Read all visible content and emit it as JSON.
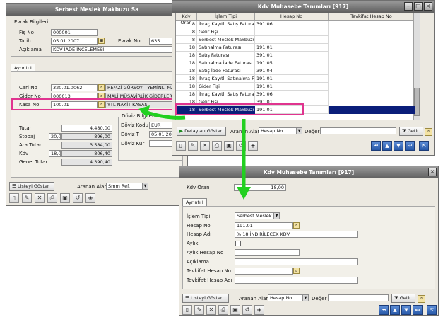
{
  "win1": {
    "title": "Serbest Meslek Makbuzu Sa",
    "evrak_group": "Evrak Bilgileri",
    "fis_no_label": "Fiş No",
    "fis_no": "000001",
    "tarih_label": "Tarih",
    "tarih": "05.01.2007",
    "evrak_no_label": "Evrak No",
    "evrak_no": "635",
    "aciklama_label": "Açıklama",
    "aciklama": "KDV İADE İNCELEMESİ",
    "tab": "Ayrıntı I",
    "cari_no_label": "Cari No",
    "cari_no": "320.01.0062",
    "cari_name": "REMZİ GÜRSOY - YEMİNLİ MALİ",
    "gider_no_label": "Gider No",
    "gider_no": "000013",
    "gider_name": "MALİ MÜŞAVİRLİK GİDERLERİ",
    "kasa_no_label": "Kasa No",
    "kasa_no": "100.01",
    "kasa_name": "YTL NAKİT  KASASI",
    "tutar_label": "Tutar",
    "tutar": "4.480,00",
    "stopaj_label": "Stopaj",
    "stopaj_rate": "20,0",
    "stopaj": "896,00",
    "ara_tutar_label": "Ara Tutar",
    "ara_tutar": "3.584,00",
    "kdv_label": "Kdv",
    "kdv_rate": "18,0",
    "kdv": "806,40",
    "genel_tutar_label": "Genel Tutar",
    "genel_tutar": "4.390,40",
    "doviz_group": "Döviz Bilgileri",
    "doviz_kodu_label": "Döviz Kodu",
    "doviz_kodu": "EUR",
    "doviz_t_label": "Döviz T",
    "doviz_t": "05.01.20",
    "doviz_kur_label": "Döviz Kur",
    "listeyi_goster": "Listeyi Göster",
    "aranan_alan_label": "Aranan Alan",
    "aranan_alan": "Smm Ref."
  },
  "win2": {
    "title": "Kdv Muhasebe Tanımları [917]",
    "columns": [
      "Kdv Oran",
      "İşlem Tipi",
      "Hesap No",
      "Tevkifat Hesap No"
    ],
    "rows": [
      [
        "8",
        "İhraç Kayıtlı Satış Faturası",
        "391.06",
        ""
      ],
      [
        "8",
        "Gelir Fişi",
        "",
        ""
      ],
      [
        "8",
        "Serbest Meslek Makbuzu",
        "",
        ""
      ],
      [
        "18",
        "Satınalma Faturası",
        "191.01",
        ""
      ],
      [
        "18",
        "Satış Faturası",
        "391.01",
        ""
      ],
      [
        "18",
        "Satınalma İade Faturası",
        "191.05",
        ""
      ],
      [
        "18",
        "Satış İade Faturası",
        "391.04",
        ""
      ],
      [
        "18",
        "İhraç Kayıtlı Satınalma Fatu",
        "191.01",
        ""
      ],
      [
        "18",
        "Gider Fişi",
        "191.01",
        ""
      ],
      [
        "18",
        "İhraç Kayıtlı Satış Faturası",
        "391.06",
        ""
      ],
      [
        "18",
        "Gelir Fişi",
        "391.01",
        ""
      ],
      [
        "18",
        "Serbest Meslek Makbuzu",
        "191.01",
        ""
      ]
    ],
    "detaylari_goster": "Detayları Göster",
    "aranan_alan_label": "Aranan Alan",
    "aranan_alan": "Hesap No",
    "deger_label": "Değer",
    "getir": "Getir"
  },
  "win3": {
    "title": "Kdv Muhasebe Tanımları [917]",
    "kdv_oran_label": "Kdv Oran",
    "kdv_oran": "18,00",
    "tab": "Ayrıntı I",
    "islem_tipi_label": "İşlem Tipi",
    "islem_tipi": "Serbest Meslek Makt",
    "hesap_no_label": "Hesap No",
    "hesap_no": "191.01",
    "hesap_adi_label": "Hesap Adı",
    "hesap_adi": "% 18 İNDİRİLECEK KDV",
    "aylik_label": "Aylık",
    "aylik_hesap_no_label": "Aylık Hesap No",
    "aciklama_label": "Açıklama",
    "tevkifat_hesap_no_label": "Tevkifat Hesap No",
    "tevkifat_hesap_adi_label": "Tevkifat Hesap Adı",
    "listeyi_goster": "Listeyi Göster",
    "aranan_alan_label": "Aranan Alan",
    "aranan_alan": "Hesap No",
    "deger_label": "Değer",
    "getir": "Getir"
  },
  "colors": {
    "highlight": "#e0348f",
    "arrow": "#22d020",
    "selection": "#0a1e7a"
  }
}
